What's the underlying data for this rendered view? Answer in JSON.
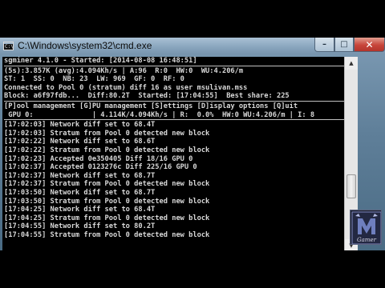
{
  "window": {
    "title": "C:\\Windows\\system32\\cmd.exe",
    "icon": "cmd-prompt-icon",
    "icon_glyph": "C:\\",
    "controls": {
      "minimize": "–",
      "maximize": "□",
      "close": "✕"
    }
  },
  "console": {
    "header": [
      "sgminer 4.1.0 - Started: [2014-08-08 16:48:51]"
    ],
    "status": [
      "(5s):3.857K (avg):4.094Kh/s | A:96  R:0  HW:0  WU:4.206/m",
      "ST: 1  SS: 0  NB: 23  LW: 969  GF: 0  RF: 0",
      "Connected to Pool 0 (stratum) diff 16 as user msulivan.mss",
      "Block: a6f97fdb...  Diff:80.2T  Started: [17:04:55]  Best share: 225"
    ],
    "menu": [
      "[P]ool management [G]PU management [S]ettings [D]isplay options [Q]uit",
      " GPU 0:              | 4.114K/4.094Kh/s | R:  0.0%  HW:0 WU:4.206/m | I: 8"
    ],
    "log": [
      "[17:02:03] Network diff set to 68.4T",
      "[17:02:03] Stratum from Pool 0 detected new block",
      "[17:02:22] Network diff set to 68.6T",
      "[17:02:22] Stratum from Pool 0 detected new block",
      "[17:02:23] Accepted 0e350405 Diff 18/16 GPU 0",
      "[17:02:37] Accepted 0123276c Diff 225/16 GPU 0",
      "[17:02:37] Network diff set to 68.7T",
      "[17:02:37] Stratum from Pool 0 detected new block",
      "[17:03:50] Network diff set to 68.7T",
      "[17:03:50] Stratum from Pool 0 detected new block",
      "[17:04:25] Network diff set to 68.4T",
      "[17:04:25] Stratum from Pool 0 detected new block",
      "[17:04:55] Network diff set to 80.2T",
      "[17:04:55] Stratum from Pool 0 detected new block"
    ]
  },
  "scrollbar": {
    "up_arrow": "▲",
    "down_arrow": "▼",
    "position_fraction": 0.72
  },
  "watermark": {
    "text": "Gamer",
    "icon": "gamer-logo-icon",
    "color_primary": "#6f7fbf",
    "color_text": "#d9d9e8"
  },
  "colors": {
    "console_bg": "#000000",
    "console_text": "#d8d8d8",
    "close_button": "#c7453a"
  }
}
